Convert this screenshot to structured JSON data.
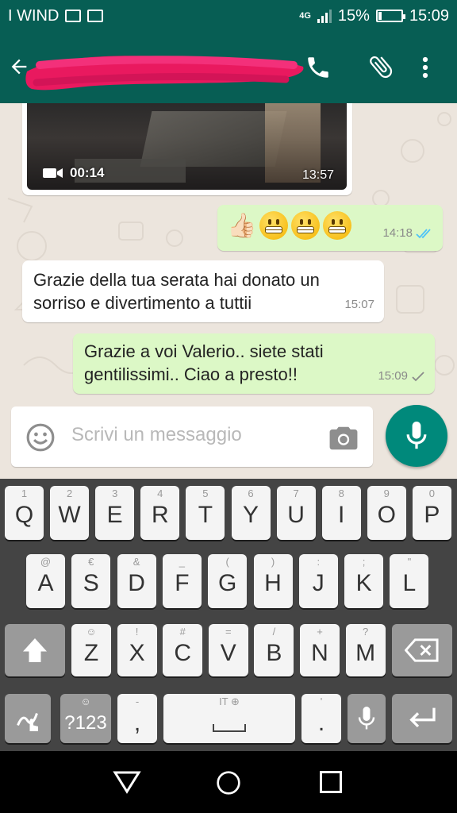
{
  "status_bar": {
    "carrier": "I WIND",
    "network": "4G",
    "battery_text": "15%",
    "battery_level": 0.15,
    "time": "15:09"
  },
  "app_bar": {
    "icons": [
      "arrow-back-icon",
      "phone-icon",
      "paperclip-icon",
      "more-vert-icon"
    ]
  },
  "messages": [
    {
      "type": "video",
      "direction": "incoming",
      "duration": "00:14",
      "time": "13:57"
    },
    {
      "type": "emoji",
      "direction": "outgoing",
      "emojis": [
        "👍🏻",
        "😬",
        "😬",
        "😬"
      ],
      "time": "14:18",
      "status": "read"
    },
    {
      "type": "text",
      "direction": "incoming",
      "lines": [
        "Grazie della tua serata hai donato un",
        "sorriso e divertimento a tuttii"
      ],
      "time": "15:07"
    },
    {
      "type": "text",
      "direction": "outgoing",
      "lines": [
        "Grazie a voi Valerio.. siete stati",
        "gentilissimi.. Ciao a presto!!"
      ],
      "time": "15:09",
      "status": "sent"
    }
  ],
  "composer": {
    "placeholder": "Scrivi un messaggio"
  },
  "keyboard": {
    "row1": [
      {
        "k": "Q",
        "s": "1"
      },
      {
        "k": "W",
        "s": "2"
      },
      {
        "k": "E",
        "s": "3"
      },
      {
        "k": "R",
        "s": "4"
      },
      {
        "k": "T",
        "s": "5"
      },
      {
        "k": "Y",
        "s": "6"
      },
      {
        "k": "U",
        "s": "7"
      },
      {
        "k": "I",
        "s": "8"
      },
      {
        "k": "O",
        "s": "9"
      },
      {
        "k": "P",
        "s": "0"
      }
    ],
    "row2": [
      {
        "k": "A",
        "s": "@"
      },
      {
        "k": "S",
        "s": "€"
      },
      {
        "k": "D",
        "s": "&"
      },
      {
        "k": "F",
        "s": "_"
      },
      {
        "k": "G",
        "s": "("
      },
      {
        "k": "H",
        "s": ")"
      },
      {
        "k": "J",
        "s": ":"
      },
      {
        "k": "K",
        "s": ";"
      },
      {
        "k": "L",
        "s": "\""
      }
    ],
    "row3": [
      {
        "k": "Z",
        "s": "☺"
      },
      {
        "k": "X",
        "s": "!"
      },
      {
        "k": "C",
        "s": "#"
      },
      {
        "k": "V",
        "s": "="
      },
      {
        "k": "B",
        "s": "/"
      },
      {
        "k": "N",
        "s": "+"
      },
      {
        "k": "M",
        "s": "?"
      }
    ],
    "symbols_label": "?123",
    "comma": ",",
    "comma_sub": "-",
    "space_label": "IT",
    "period": ".",
    "period_sub": "'"
  },
  "nav_bar": {
    "icons": [
      "back-triangle-icon",
      "home-circle-icon",
      "recents-square-icon"
    ]
  },
  "colors": {
    "header": "#075E54",
    "outgoing_bubble": "#DCF8C6",
    "incoming_bubble": "#FFFFFF",
    "chat_bg": "#ECE5DD",
    "fab": "#00897B",
    "read_ticks": "#4FC3F7"
  }
}
